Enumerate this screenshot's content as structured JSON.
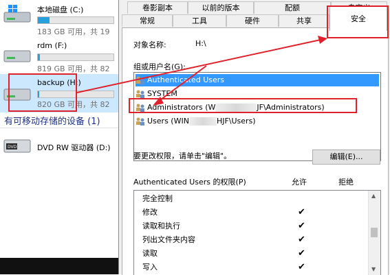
{
  "explorer": {
    "drives": [
      {
        "name": "本地磁盘 (C:)",
        "free": "183 GB 可用，共 19",
        "fill": 0.15
      },
      {
        "name": "rdm (F:)",
        "free": "819 GB 可用，共 82",
        "fill": 0.03
      },
      {
        "name": "backup (H:)",
        "free": "820 GB 可用，共 82",
        "fill": 0.02
      }
    ],
    "removable_header": "有可移动存储的设备 (1)",
    "dvd": {
      "name": "DVD RW 驱动器 (D:)"
    }
  },
  "dialog": {
    "tabs_row1": [
      "卷影副本",
      "以前的版本",
      "配额",
      "自定义"
    ],
    "tabs_row2": [
      "常规",
      "工具",
      "硬件",
      "共享",
      "安全"
    ],
    "object_label": "对象名称:",
    "object_value": "H:\\",
    "group_label": "组或用户名(G):",
    "users": [
      {
        "text": "Authenticated Users",
        "selected": true
      },
      {
        "text": "SYSTEM",
        "selected": false
      },
      {
        "text": "Administrators (W",
        "suffix": "JF\\Administrators)",
        "selected": false
      },
      {
        "text": "Users (WIN",
        "suffix": "HJF\\Users)",
        "selected": false
      }
    ],
    "change_perm_text": "要更改权限，请单击\"编辑\"。",
    "edit_button": "编辑(E)...",
    "perm_title": "Authenticated Users 的权限(P)",
    "allow": "允许",
    "deny": "拒绝",
    "permissions": [
      {
        "name": "完全控制",
        "allow": false
      },
      {
        "name": "修改",
        "allow": true
      },
      {
        "name": "读取和执行",
        "allow": true
      },
      {
        "name": "列出文件夹内容",
        "allow": true
      },
      {
        "name": "读取",
        "allow": true
      },
      {
        "name": "写入",
        "allow": true
      }
    ],
    "check_glyph": "✔"
  },
  "colors": {
    "annotation": "#e0202a",
    "selection": "#3399ff"
  }
}
